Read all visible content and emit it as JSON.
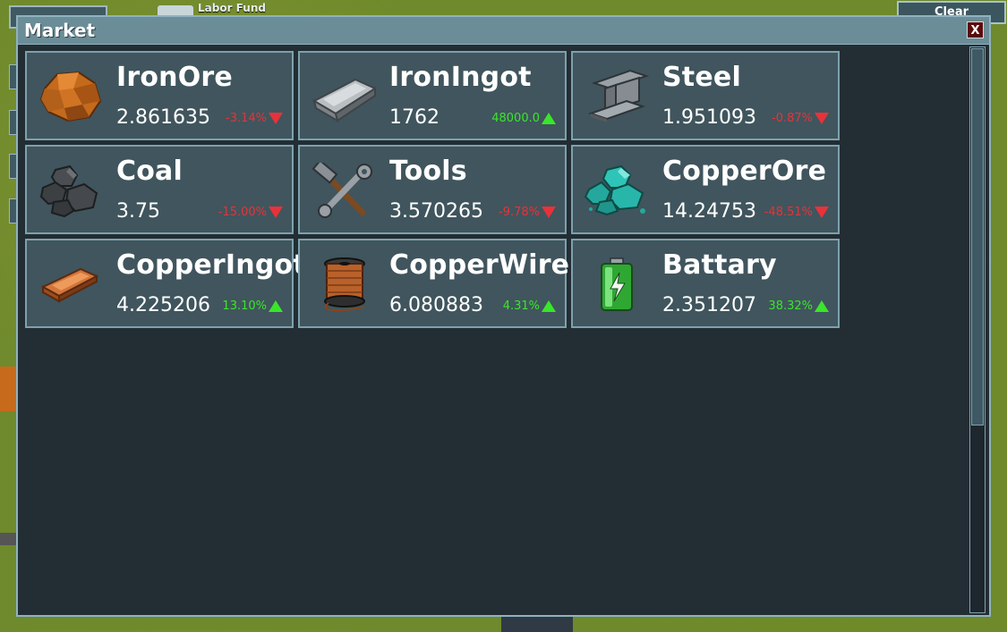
{
  "hud": {
    "labor_fund_label": "Labor Fund",
    "clear_everything_label": "Clear Everything"
  },
  "market": {
    "title": "Market",
    "close_label": "X",
    "items": [
      {
        "name": "IronOre",
        "price": "2.861635",
        "change": "-3.14%",
        "direction": "down",
        "icon": "iron-ore-icon"
      },
      {
        "name": "IronIngot",
        "price": "1762",
        "change": "48000.0",
        "direction": "up",
        "icon": "iron-ingot-icon"
      },
      {
        "name": "Steel",
        "price": "1.951093",
        "change": "-0.87%",
        "direction": "down",
        "icon": "steel-beam-icon"
      },
      {
        "name": "Coal",
        "price": "3.75",
        "change": "-15.00%",
        "direction": "down",
        "icon": "coal-icon"
      },
      {
        "name": "Tools",
        "price": "3.570265",
        "change": "-9.78%",
        "direction": "down",
        "icon": "tools-icon"
      },
      {
        "name": "CopperOre",
        "price": "14.24753",
        "change": "-48.51%",
        "direction": "down",
        "icon": "copper-ore-icon"
      },
      {
        "name": "CopperIngot",
        "price": "4.225206",
        "change": "13.10%",
        "direction": "up",
        "icon": "copper-ingot-icon"
      },
      {
        "name": "CopperWire",
        "price": "6.080883",
        "change": "4.31%",
        "direction": "up",
        "icon": "copper-wire-icon"
      },
      {
        "name": "Battary",
        "price": "2.351207",
        "change": "38.32%",
        "direction": "up",
        "icon": "battery-icon"
      }
    ]
  },
  "colors": {
    "up": "#39e62a",
    "down": "#e8323a",
    "header": "#6a8d98",
    "card": "#40555d"
  }
}
